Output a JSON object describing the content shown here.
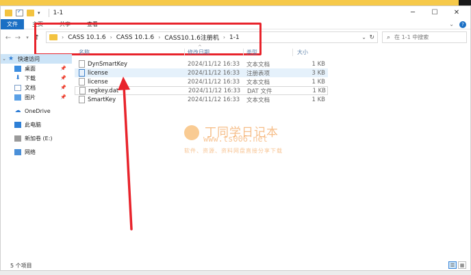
{
  "window": {
    "title": "1-1",
    "controls": {
      "minimize": "─",
      "maximize": "☐",
      "close": "✕"
    }
  },
  "ribbon": {
    "tabs": [
      "文件",
      "主页",
      "共享",
      "查看"
    ],
    "chevron": "⌄"
  },
  "address": {
    "breadcrumb": [
      "CASS 10.1.6",
      "CASS 10.1.6",
      "CASS10.1.6注册机",
      "1-1"
    ],
    "search_placeholder": "在 1-1 中搜索"
  },
  "nav": {
    "quick_access": "快速访问",
    "items": [
      {
        "label": "桌面",
        "icon": "desktop-icon"
      },
      {
        "label": "下载",
        "icon": "download-icon"
      },
      {
        "label": "文档",
        "icon": "documents-icon"
      },
      {
        "label": "图片",
        "icon": "pictures-icon"
      }
    ],
    "onedrive": "OneDrive",
    "this_pc": "此电脑",
    "drive": "新加卷 (E:)",
    "network": "网络"
  },
  "columns": {
    "name": "名称",
    "date": "修改日期",
    "type": "类型",
    "size": "大小"
  },
  "files": [
    {
      "name": "DynSmartKey",
      "date": "2024/11/12 16:33",
      "type": "文本文档",
      "size": "1 KB",
      "icon": "text-file-icon"
    },
    {
      "name": "license",
      "date": "2024/11/12 16:33",
      "type": "注册表项",
      "size": "3 KB",
      "icon": "registry-file-icon"
    },
    {
      "name": "license",
      "date": "2024/11/12 16:33",
      "type": "文本文档",
      "size": "1 KB",
      "icon": "text-file-icon"
    },
    {
      "name": "regkey.dat",
      "date": "2024/11/12 16:33",
      "type": "DAT 文件",
      "size": "1 KB",
      "icon": "dat-file-icon"
    },
    {
      "name": "SmartKey",
      "date": "2024/11/12 16:33",
      "type": "文本文档",
      "size": "1 KB",
      "icon": "text-file-icon"
    }
  ],
  "status": {
    "count": "5 个项目"
  },
  "watermark": {
    "title": "丁同学日记本",
    "url": "www.ts006.net",
    "subtitle": "软件、资源、资料网盘直接分享下载"
  },
  "colors": {
    "highlight": "#e8232b",
    "accent": "#1a6fc4"
  }
}
